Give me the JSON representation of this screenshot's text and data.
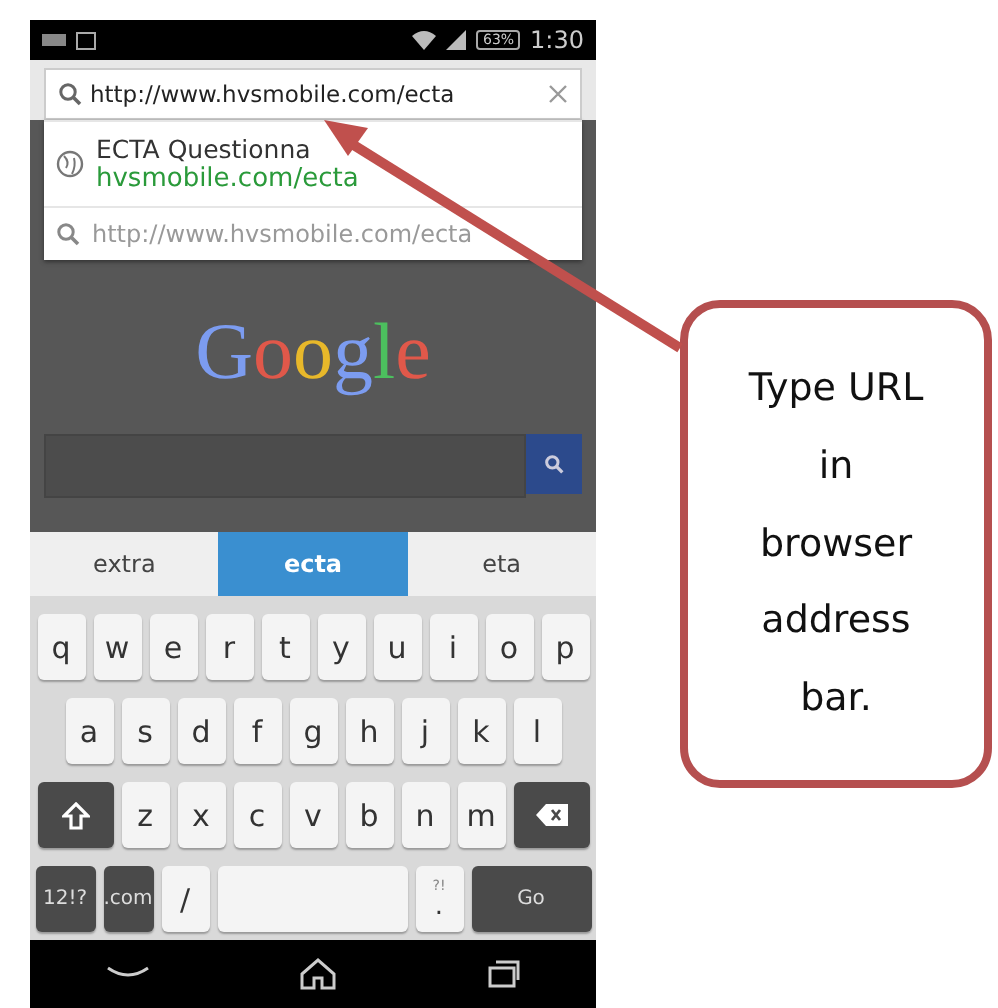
{
  "status_bar": {
    "battery": "63%",
    "time": "1:30"
  },
  "address_bar": {
    "value": "http://www.hvsmobile.com/ecta"
  },
  "suggestions": [
    {
      "kind": "page",
      "title": "ECTA Questionna",
      "url": "hvsmobile.com/ecta"
    },
    {
      "kind": "search",
      "title": "http://www.hvsmobile.com/ecta"
    }
  ],
  "page": {
    "logo": "Google"
  },
  "word_suggestions": [
    {
      "label": "extra",
      "selected": false
    },
    {
      "label": "ecta",
      "selected": true
    },
    {
      "label": "eta",
      "selected": false
    }
  ],
  "keyboard": {
    "rows": [
      [
        {
          "kind": "letter",
          "label": "q"
        },
        {
          "kind": "letter",
          "label": "w"
        },
        {
          "kind": "letter",
          "label": "e"
        },
        {
          "kind": "letter",
          "label": "r"
        },
        {
          "kind": "letter",
          "label": "t"
        },
        {
          "kind": "letter",
          "label": "y"
        },
        {
          "kind": "letter",
          "label": "u"
        },
        {
          "kind": "letter",
          "label": "i"
        },
        {
          "kind": "letter",
          "label": "o"
        },
        {
          "kind": "letter",
          "label": "p"
        }
      ],
      [
        {
          "kind": "letter",
          "label": "a"
        },
        {
          "kind": "letter",
          "label": "s"
        },
        {
          "kind": "letter",
          "label": "d"
        },
        {
          "kind": "letter",
          "label": "f"
        },
        {
          "kind": "letter",
          "label": "g"
        },
        {
          "kind": "letter",
          "label": "h"
        },
        {
          "kind": "letter",
          "label": "j"
        },
        {
          "kind": "letter",
          "label": "k"
        },
        {
          "kind": "letter",
          "label": "l"
        }
      ],
      [
        {
          "kind": "shift"
        },
        {
          "kind": "letter",
          "label": "z"
        },
        {
          "kind": "letter",
          "label": "x"
        },
        {
          "kind": "letter",
          "label": "c"
        },
        {
          "kind": "letter",
          "label": "v"
        },
        {
          "kind": "letter",
          "label": "b"
        },
        {
          "kind": "letter",
          "label": "n"
        },
        {
          "kind": "letter",
          "label": "m"
        },
        {
          "kind": "backspace"
        }
      ],
      [
        {
          "kind": "symbols",
          "label": "12!?"
        },
        {
          "kind": "domain",
          "label": ".com"
        },
        {
          "kind": "letter",
          "label": "/"
        },
        {
          "kind": "space"
        },
        {
          "kind": "punct",
          "label": ".",
          "alt": "?!"
        },
        {
          "kind": "go",
          "label": "Go"
        }
      ]
    ]
  },
  "callout": {
    "lines": [
      "Type URL",
      "in",
      "browser",
      "address",
      "bar."
    ]
  }
}
